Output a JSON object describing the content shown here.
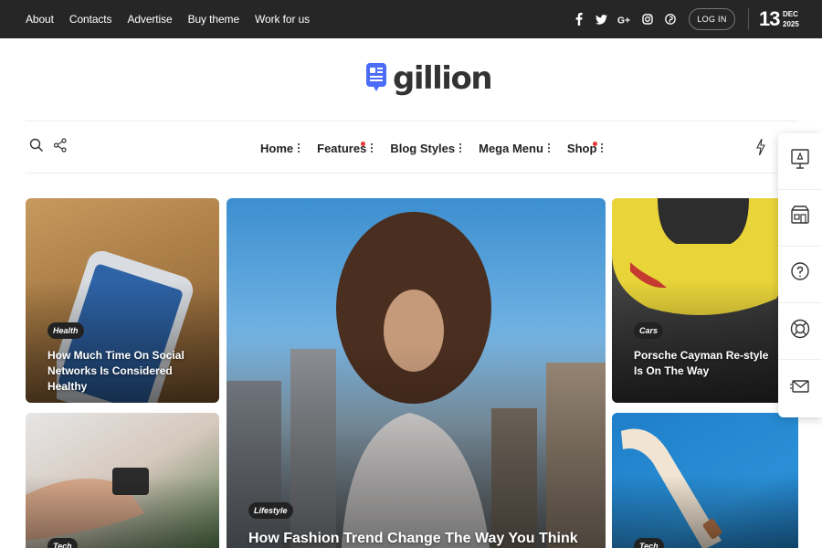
{
  "topbar": {
    "links": [
      "About",
      "Contacts",
      "Advertise",
      "Buy theme",
      "Work for us"
    ],
    "socials": [
      "facebook-icon",
      "twitter-icon",
      "google-plus-icon",
      "instagram-icon",
      "pinterest-icon"
    ],
    "login_label": "LOG IN",
    "date_day": "13",
    "date_month": "DEC",
    "date_year": "2025"
  },
  "logo": {
    "text": "gillion",
    "icon": "document-chat-icon",
    "accent": "#4a6cf7"
  },
  "nav": {
    "left_icons": [
      "search-icon",
      "share-icon"
    ],
    "items": [
      {
        "label": "Home",
        "new_dot": false
      },
      {
        "label": "Features",
        "new_dot": true
      },
      {
        "label": "Blog Styles",
        "new_dot": false
      },
      {
        "label": "Mega Menu",
        "new_dot": false
      },
      {
        "label": "Shop",
        "new_dot": true
      }
    ],
    "right_icon": "bolt-icon",
    "dot_color": "#e53935"
  },
  "side_widget": {
    "icons": [
      "presentation-icon",
      "shop-icon",
      "help-bubble-icon",
      "lifebuoy-icon",
      "mail-icon"
    ]
  },
  "cards": [
    {
      "category": "Health",
      "title": "How Much Time On Social Networks Is Considered Healthy"
    },
    {
      "category": "Lifestyle",
      "title": "How Fashion Trend Change The Way You Think"
    },
    {
      "category": "Cars",
      "title": "Porsche Cayman Re-style Is On The Way"
    },
    {
      "category": "Tech",
      "title": ""
    },
    {
      "category": "Tech",
      "title": ""
    }
  ]
}
